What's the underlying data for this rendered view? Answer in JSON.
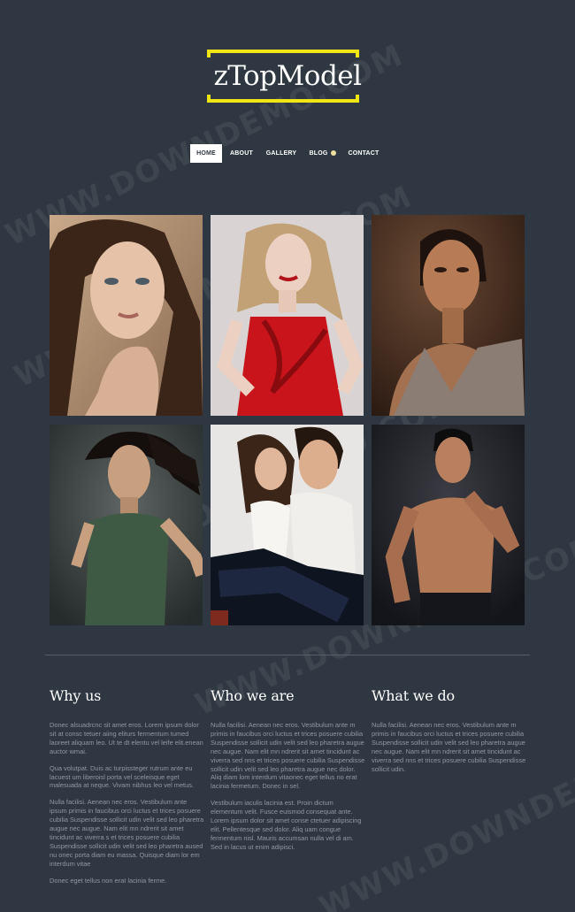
{
  "brand": {
    "name": "zTopModel",
    "accent": "#f0e614"
  },
  "nav": {
    "items": [
      {
        "label": "HOME",
        "active": true
      },
      {
        "label": "ABOUT",
        "active": false
      },
      {
        "label": "GALLERY",
        "active": false
      },
      {
        "label": "BLOG",
        "active": false
      },
      {
        "label": "CONTACT",
        "active": false
      }
    ]
  },
  "gallery": {
    "photos": [
      {
        "subject": "woman-brunette-portrait"
      },
      {
        "subject": "woman-blonde-red-dress"
      },
      {
        "subject": "woman-dark-portrait"
      },
      {
        "subject": "woman-green-top"
      },
      {
        "subject": "couple-jeans"
      },
      {
        "subject": "man-shirtless"
      }
    ]
  },
  "columns": [
    {
      "title": "Why us",
      "paragraphs": [
        "Donec alsuadrcnc sit amet eros. Lorem ipsum dolor sit at consc tetuer aiing eliturs fermentum tumed laoreet aliquam leo. Ut te dt elentu vel leife elit.enean auctor wmai.",
        "Qua volutpat. Duis ac turpissteger rutrum ante eu lacuest um liberoisl porta vel sceleisque eget malesuada at neque. Vivam nibhus leo vel metus.",
        "Nulla facilisi. Aenean nec eros. Vestibulum ante ipsum primis in faucibus orci luctus et trices posuere cubilia Suspendisse sollicit udin velit sed leo pharetra augue nec augue. Nam elit mn ndrerit sit amet tincidunt ac viverra s et trices posuere cubilia Suspendisse sollicit udin velit sed leo pharetra aused nu onec porta diam eu massa. Quisque diam lor em interdum vitae",
        "Donec eget tellus non erat lacinia ferme."
      ]
    },
    {
      "title": "Who we are",
      "paragraphs": [
        "Nulla facilisi. Aenean nec eros. Vestibulum ante m primis in faucibus orci luctus et trices posuere cubilia Suspendisse sollicit udin velit sed leo pharetra augue nec augue. Nam elit mn ndrerit sit amet tincidunt ac viverra sed nns et trices posuere cubilia Suspendisse sollicit udin velit sed leo pharetra augue nec dolor. Aliq diam lom interdum vitaonec eget tellus no erat lacinia fermetum. Donec in sel.",
        "Vestibulum iaculis lacinia est. Proin dictum elementum velit. Fusce euismod consequat ante. Lorem ipsum dolor sit amet conse ctetuer adipiscing elit. Pellentesque sed dolor. Aliq uam congue fermentum nisl. Mauris accumsan nulla vel di am. Sed in lacus ut enim adipisci."
      ]
    },
    {
      "title": "What we do",
      "paragraphs": [
        "Nulla facilisi. Aenean nec eros. Vestibulum ante m primis in faucibus orci luctus et trices posuere cubilia Suspendisse sollicit udin velit sed leo pharetra augue nec augue. Nam elit mn ndrerit sit amet tincidunt ac viverra sed nns et trices posuere cubilia Suspendisse sollicit udin."
      ]
    }
  ],
  "watermark": {
    "text": "WWW.DOWNDEMO.COM"
  }
}
